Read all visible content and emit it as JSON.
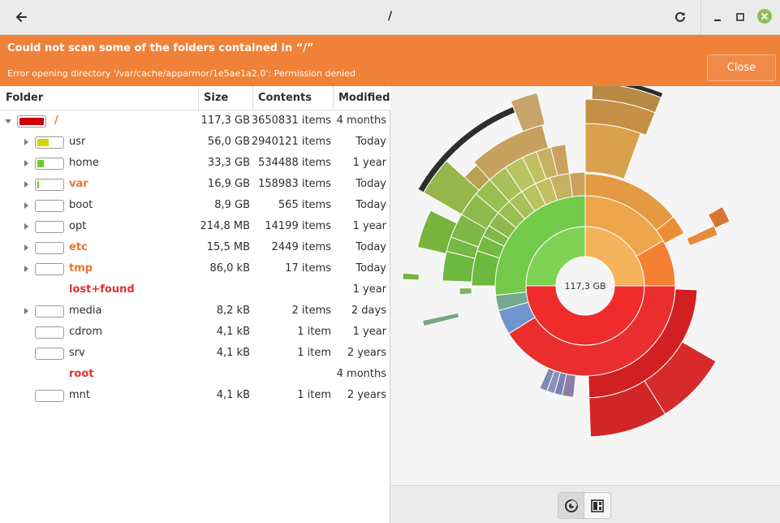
{
  "window": {
    "title": "/"
  },
  "infobar": {
    "title": "Could not scan some of the folders contained in “/”",
    "message": "Error opening directory '/var/cache/apparmor/1e5ae1a2.0': Permission denied",
    "close_label": "Close"
  },
  "columns": {
    "folder": "Folder",
    "size": "Size",
    "contents": "Contents",
    "modified": "Modified"
  },
  "rows": [
    {
      "name": "/",
      "size": "117,3 GB",
      "items": "3650831 items",
      "modified": "4 months",
      "usage": 1.0,
      "bar_color": "#cc0000",
      "style": "orange",
      "expander": "down"
    },
    {
      "name": "usr",
      "size": "56,0 GB",
      "items": "2940121 items",
      "modified": "Today",
      "usage": 0.48,
      "bar_color": "#d4d400",
      "style": "normal",
      "expander": "right"
    },
    {
      "name": "home",
      "size": "33,3 GB",
      "items": "534488 items",
      "modified": "1 year",
      "usage": 0.28,
      "bar_color": "#6ac830",
      "style": "normal",
      "expander": "right"
    },
    {
      "name": "var",
      "size": "16,9 GB",
      "items": "158983 items",
      "modified": "Today",
      "usage": 0.14,
      "bar_color": "#6ac830",
      "style": "orange",
      "expander": "right"
    },
    {
      "name": "boot",
      "size": "8,9 GB",
      "items": "565 items",
      "modified": "Today",
      "usage": 0.0,
      "bar_color": "#6ac830",
      "style": "normal",
      "expander": "right"
    },
    {
      "name": "opt",
      "size": "214,8 MB",
      "items": "14199 items",
      "modified": "1 year",
      "usage": 0.0,
      "bar_color": "#6ac830",
      "style": "normal",
      "expander": "right"
    },
    {
      "name": "etc",
      "size": "15,5 MB",
      "items": "2449 items",
      "modified": "Today",
      "usage": 0.0,
      "bar_color": "#6ac830",
      "style": "orange",
      "expander": "right"
    },
    {
      "name": "tmp",
      "size": "86,0 kB",
      "items": "17 items",
      "modified": "Today",
      "usage": 0.0,
      "bar_color": "#6ac830",
      "style": "orange",
      "expander": "right"
    },
    {
      "name": "lost+found",
      "size": "",
      "items": "",
      "modified": "1 year",
      "usage": null,
      "bar_color": "",
      "style": "red",
      "expander": "none"
    },
    {
      "name": "media",
      "size": "8,2 kB",
      "items": "2 items",
      "modified": "2 days",
      "usage": 0.0,
      "bar_color": "#6ac830",
      "style": "normal",
      "expander": "right"
    },
    {
      "name": "cdrom",
      "size": "4,1 kB",
      "items": "1 item",
      "modified": "1 year",
      "usage": 0.0,
      "bar_color": "#6ac830",
      "style": "normal",
      "expander": "none"
    },
    {
      "name": "srv",
      "size": "4,1 kB",
      "items": "1 item",
      "modified": "2 years",
      "usage": 0.0,
      "bar_color": "#6ac830",
      "style": "normal",
      "expander": "none"
    },
    {
      "name": "root",
      "size": "",
      "items": "",
      "modified": "4 months",
      "usage": null,
      "bar_color": "",
      "style": "red",
      "expander": "none"
    },
    {
      "name": "mnt",
      "size": "4,1 kB",
      "items": "1 item",
      "modified": "2 years",
      "usage": 0.0,
      "bar_color": "#6ac830",
      "style": "normal",
      "expander": "none"
    }
  ],
  "chart": {
    "center_label": "117,3 GB"
  },
  "icons": {
    "back": "back-arrow-icon",
    "reload": "reload-icon",
    "minimize": "minimize-icon",
    "maximize": "maximize-icon",
    "close": "close-icon",
    "rings_view": "rings-chart-icon",
    "treemap_view": "treemap-chart-icon"
  }
}
